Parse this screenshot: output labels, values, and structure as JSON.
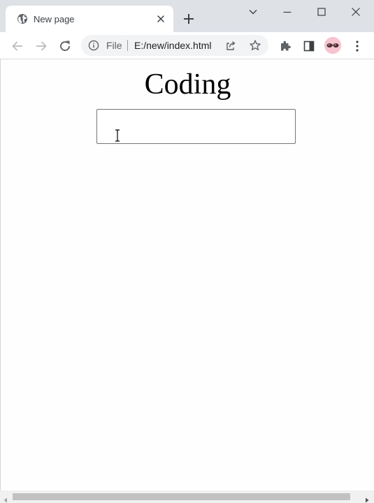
{
  "browser": {
    "tab": {
      "title": "New page",
      "favicon": "globe-icon",
      "close_icon": "close-icon"
    },
    "new_tab_icon": "plus-icon",
    "window_controls": [
      "tab-search-icon",
      "minimize-icon",
      "maximize-icon",
      "close-icon"
    ],
    "toolbar": {
      "back_icon": "arrow-left-icon",
      "forward_icon": "arrow-right-icon",
      "reload_icon": "reload-icon",
      "extensions_icon": "puzzle-icon",
      "side_panel_icon": "side-panel-icon",
      "menu_icon": "kebab-menu-icon"
    },
    "omnibox": {
      "info_icon": "info-icon",
      "scheme_chip": "File",
      "url": "E:/new/index.html",
      "share_icon": "share-icon",
      "bookmark_icon": "star-icon"
    },
    "avatar": "profile-avatar"
  },
  "page": {
    "heading": "Coding",
    "input": {
      "value": "",
      "placeholder": ""
    }
  },
  "colors": {
    "tabstrip_bg": "#dee1e6",
    "omnibox_bg": "#f1f3f4",
    "icon": "#5f6368",
    "avatar_bg": "#f6c4cf"
  }
}
